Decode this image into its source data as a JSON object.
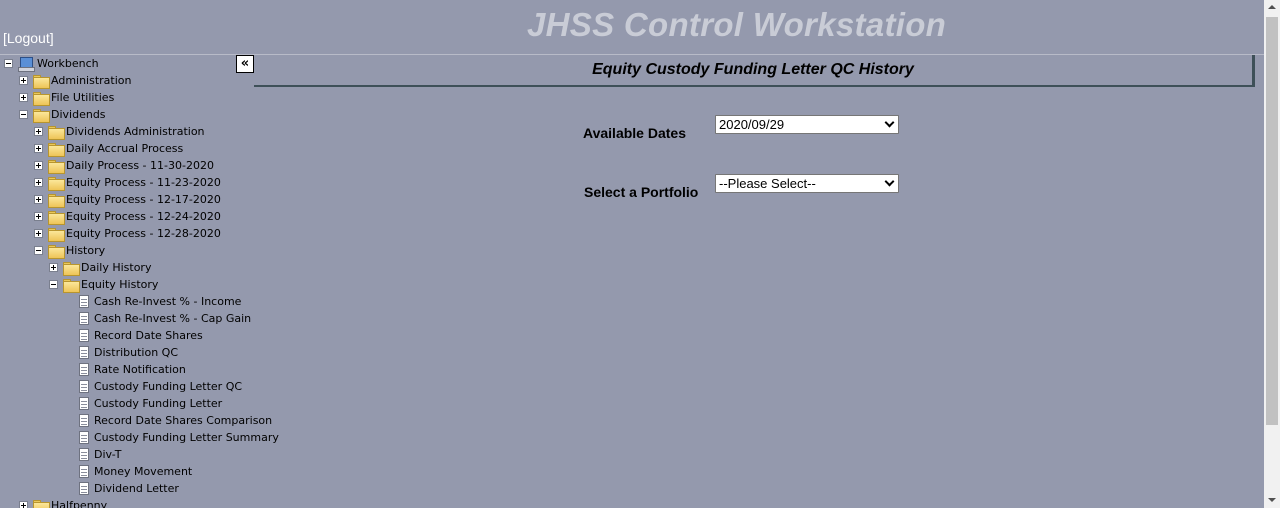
{
  "header": {
    "logout_label": "[Logout]",
    "app_title": "JHSS Control Workstation",
    "collapse_label": "«"
  },
  "tree": {
    "items": [
      {
        "label": "Workbench",
        "icon": "computer-icon",
        "toggle": "minus",
        "depth": 0
      },
      {
        "label": "Administration",
        "icon": "folder-icon",
        "toggle": "plus",
        "depth": 1
      },
      {
        "label": "File Utilities",
        "icon": "folder-icon",
        "toggle": "plus",
        "depth": 1
      },
      {
        "label": "Dividends",
        "icon": "folder-icon",
        "toggle": "minus",
        "depth": 1
      },
      {
        "label": "Dividends Administration",
        "icon": "folder-icon",
        "toggle": "plus",
        "depth": 2
      },
      {
        "label": "Daily Accrual Process",
        "icon": "folder-icon",
        "toggle": "plus",
        "depth": 2
      },
      {
        "label": "Daily Process - 11-30-2020",
        "icon": "folder-icon",
        "toggle": "plus",
        "depth": 2
      },
      {
        "label": "Equity Process - 11-23-2020",
        "icon": "folder-icon",
        "toggle": "plus",
        "depth": 2
      },
      {
        "label": "Equity Process - 12-17-2020",
        "icon": "folder-icon",
        "toggle": "plus",
        "depth": 2
      },
      {
        "label": "Equity Process - 12-24-2020",
        "icon": "folder-icon",
        "toggle": "plus",
        "depth": 2
      },
      {
        "label": "Equity Process - 12-28-2020",
        "icon": "folder-icon",
        "toggle": "plus",
        "depth": 2
      },
      {
        "label": "History",
        "icon": "folder-icon",
        "toggle": "minus",
        "depth": 2
      },
      {
        "label": "Daily History",
        "icon": "folder-icon",
        "toggle": "plus",
        "depth": 3
      },
      {
        "label": "Equity History",
        "icon": "folder-icon",
        "toggle": "minus",
        "depth": 3
      },
      {
        "label": "Cash Re-Invest % - Income",
        "icon": "document-icon",
        "toggle": "none",
        "depth": 4
      },
      {
        "label": "Cash Re-Invest % - Cap Gain",
        "icon": "document-icon",
        "toggle": "none",
        "depth": 4
      },
      {
        "label": "Record Date Shares",
        "icon": "document-icon",
        "toggle": "none",
        "depth": 4
      },
      {
        "label": "Distribution QC",
        "icon": "document-icon",
        "toggle": "none",
        "depth": 4
      },
      {
        "label": "Rate Notification",
        "icon": "document-icon",
        "toggle": "none",
        "depth": 4
      },
      {
        "label": "Custody Funding Letter QC",
        "icon": "document-icon",
        "toggle": "none",
        "depth": 4
      },
      {
        "label": "Custody Funding Letter",
        "icon": "document-icon",
        "toggle": "none",
        "depth": 4
      },
      {
        "label": "Record Date Shares Comparison",
        "icon": "document-icon",
        "toggle": "none",
        "depth": 4
      },
      {
        "label": "Custody Funding Letter Summary",
        "icon": "document-icon",
        "toggle": "none",
        "depth": 4
      },
      {
        "label": "Div-T",
        "icon": "document-icon",
        "toggle": "none",
        "depth": 4
      },
      {
        "label": "Money Movement",
        "icon": "document-icon",
        "toggle": "none",
        "depth": 4
      },
      {
        "label": "Dividend Letter",
        "icon": "document-icon",
        "toggle": "none",
        "depth": 4
      },
      {
        "label": "Halfpenny",
        "icon": "folder-icon",
        "toggle": "plus",
        "depth": 1
      }
    ]
  },
  "main": {
    "title": "Equity Custody Funding Letter QC History",
    "available_dates_label": "Available Dates",
    "available_dates_value": "2020/09/29",
    "portfolio_label": "Select a Portfolio",
    "portfolio_value": "--Please Select--"
  }
}
